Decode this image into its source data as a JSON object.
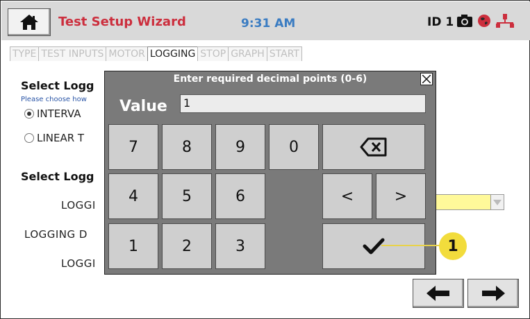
{
  "header": {
    "title": "Test Setup Wizard",
    "time": "9:31 AM",
    "device_id": "ID 1",
    "icons": [
      "home-icon",
      "camera-icon",
      "globe-icon",
      "network-icon"
    ]
  },
  "tabs": [
    "TYPE",
    "TEST INPUTS",
    "MOTOR",
    "LOGGING",
    "STOP",
    "GRAPH",
    "START"
  ],
  "active_tab": "LOGGING",
  "page": {
    "heading1": "Select Logg",
    "helper": "Please choose how",
    "radio1": "INTERVA",
    "radio2": "LINEAR T",
    "heading2": "Select Logg",
    "field1": "LOGGI",
    "field2": "LOGGING D",
    "field3": "LOGGI"
  },
  "dialog": {
    "title": "Enter required decimal points (0-6)",
    "value_label": "Value",
    "value": "1",
    "keys": {
      "k7": "7",
      "k8": "8",
      "k9": "9",
      "k0": "0",
      "k4": "4",
      "k5": "5",
      "k6": "6",
      "k1": "1",
      "k2": "2",
      "k3": "3",
      "left": "<",
      "right": ">"
    }
  },
  "callout": "1",
  "colors": {
    "title": "#cc2e3d",
    "time": "#3a7cc2",
    "dropdown": "#fff99a",
    "callout": "#f2dc3c"
  }
}
